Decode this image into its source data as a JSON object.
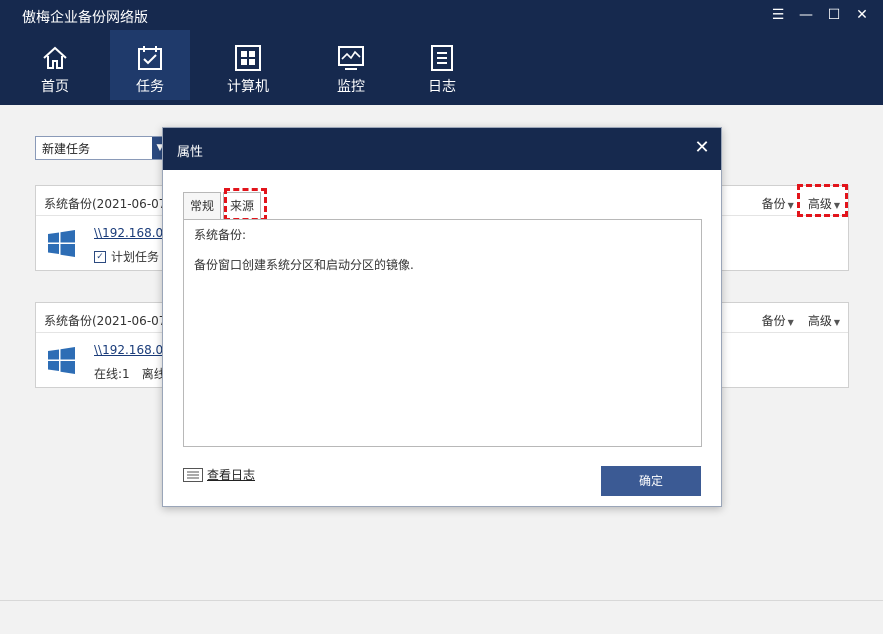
{
  "app": {
    "title": "傲梅企业备份网络版"
  },
  "nav": {
    "items": [
      {
        "label": "首页",
        "icon": "home-icon"
      },
      {
        "label": "任务",
        "icon": "task-calendar-icon",
        "active": true
      },
      {
        "label": "计算机",
        "icon": "computer-icon"
      },
      {
        "label": "监控",
        "icon": "monitor-icon"
      },
      {
        "label": "日志",
        "icon": "log-icon"
      }
    ]
  },
  "toolbar": {
    "new_task": "新建任务"
  },
  "tasks": [
    {
      "title": "系统备份(2021-06-07",
      "backup_label": "备份",
      "advanced_label": "高级",
      "path": "\\\\192.168.0.1",
      "sub_text": "计划任务",
      "sub_checked": true
    },
    {
      "title": "系统备份(2021-06-07",
      "backup_label": "备份",
      "advanced_label": "高级",
      "path": "\\\\192.168.0.1",
      "sub_online": "在线:1",
      "sub_offline": "离线"
    }
  ],
  "dialog": {
    "title": "属性",
    "tabs": [
      {
        "label": "常规"
      },
      {
        "label": "来源",
        "active": true
      }
    ],
    "panel": {
      "line1": "系统备份:",
      "line2": "备份窗口创建系统分区和启动分区的镜像."
    },
    "view_log": "查看日志",
    "ok_label": "确定"
  },
  "colors": {
    "header_bg": "#16294e",
    "accent": "#3b5a94",
    "highlight": "#e2141b"
  }
}
